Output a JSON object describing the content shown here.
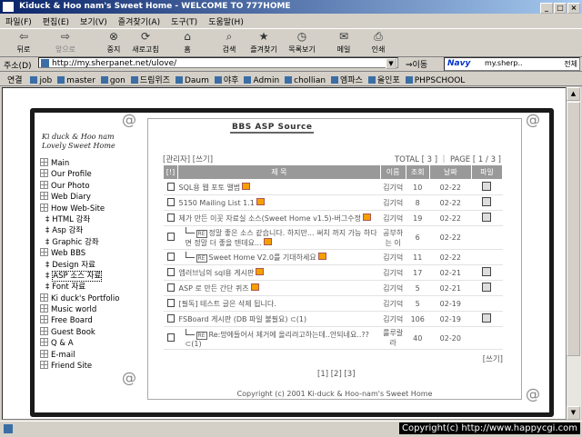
{
  "window": {
    "title_left": "Kiduck & Hoo nam's Sweet Home",
    "title_right": "- WELCOME TO 777HOME",
    "buttons": [
      "_",
      "□",
      "×"
    ]
  },
  "menu": [
    "파일(F)",
    "편집(E)",
    "보기(V)",
    "즐겨찾기(A)",
    "도구(T)",
    "도움말(H)"
  ],
  "toolbar": [
    {
      "label": "뒤로",
      "icon": "back-arrow-icon",
      "glyph": "⇦",
      "enabled": true
    },
    {
      "label": "앞으로",
      "icon": "forward-arrow-icon",
      "glyph": "⇨",
      "enabled": false
    },
    {
      "label": "중지",
      "icon": "stop-icon",
      "glyph": "⊗",
      "enabled": true
    },
    {
      "label": "새로고침",
      "icon": "refresh-icon",
      "glyph": "⟳",
      "enabled": true
    },
    {
      "label": "홈",
      "icon": "home-icon",
      "glyph": "⌂",
      "enabled": true
    },
    {
      "label": "검색",
      "icon": "search-icon",
      "glyph": "⌕",
      "enabled": true
    },
    {
      "label": "즐겨찾기",
      "icon": "favorites-icon",
      "glyph": "★",
      "enabled": true
    },
    {
      "label": "목록보기",
      "icon": "history-icon",
      "glyph": "◷",
      "enabled": true
    },
    {
      "label": "메일",
      "icon": "mail-icon",
      "glyph": "✉",
      "enabled": true
    },
    {
      "label": "인쇄",
      "icon": "print-icon",
      "glyph": "⎙",
      "enabled": true
    }
  ],
  "address": {
    "label": "주소(D)",
    "url": "http://my.sherpanet.net/ulove/",
    "go": "⇒이동",
    "navy_logo": "Navy",
    "navy_search": "my.sherp..",
    "navy_all": "전체"
  },
  "links": {
    "label": "연결",
    "items": [
      "job",
      "master",
      "gon",
      "드림위즈",
      "Daum",
      "야후",
      "Admin",
      "chollian",
      "엠파스",
      "올인포",
      "PHPSCHOOL"
    ]
  },
  "site": {
    "logo_line1": "Ki duck & Hoo nam",
    "logo_line2": "Lovely Sweet Home",
    "nav": [
      {
        "label": "Main",
        "sub": false,
        "selected": false
      },
      {
        "label": "Our Profile",
        "sub": false,
        "selected": false
      },
      {
        "label": "Our Photo",
        "sub": false,
        "selected": false
      },
      {
        "label": "Web Diary",
        "sub": false,
        "selected": false
      },
      {
        "label": "How Web-Site",
        "sub": false,
        "selected": false
      },
      {
        "label": "HTML 강좌",
        "sub": true,
        "selected": false
      },
      {
        "label": "Asp 강좌",
        "sub": true,
        "selected": false
      },
      {
        "label": "Graphic 강좌",
        "sub": true,
        "selected": false
      },
      {
        "label": "Web BBS",
        "sub": false,
        "selected": false
      },
      {
        "label": "Design 자료",
        "sub": true,
        "selected": false
      },
      {
        "label": "ASP 소스 자료",
        "sub": true,
        "selected": true
      },
      {
        "label": "Font 자료",
        "sub": true,
        "selected": false
      },
      {
        "label": "Ki duck's Portfolio",
        "sub": false,
        "selected": false
      },
      {
        "label": "Music world",
        "sub": false,
        "selected": false
      },
      {
        "label": "Free Board",
        "sub": false,
        "selected": false
      },
      {
        "label": "Guest Book",
        "sub": false,
        "selected": false
      },
      {
        "label": "Q & A",
        "sub": false,
        "selected": false
      },
      {
        "label": "E-mail",
        "sub": false,
        "selected": false
      },
      {
        "label": "Friend Site",
        "sub": false,
        "selected": false
      }
    ],
    "board": {
      "title": "BBS ASP Source",
      "admin": "[관리자]",
      "write": "[쓰기]",
      "total": "TOTAL [ 3 ] ｜ PAGE [ 1 / 3 ]",
      "columns": [
        "[!]",
        "제 목",
        "이름",
        "조회",
        "날짜",
        "파일"
      ],
      "rows": [
        {
          "title": "SQL용 웹 포토 앨범",
          "name": "김기덕",
          "views": "10",
          "date": "02-22",
          "reply": false,
          "new": true,
          "file": true
        },
        {
          "title": "5150 Mailing List 1.1",
          "name": "김기덕",
          "views": "8",
          "date": "02-22",
          "reply": false,
          "new": true,
          "file": true
        },
        {
          "title": "제가 만든 이꼿 자료실 소스(Sweet Home v1.5)-버그수정",
          "name": "김기덕",
          "views": "19",
          "date": "02-22",
          "reply": false,
          "new": true,
          "file": true
        },
        {
          "title": "정말 좋은 소스 같습니다. 하지만... 써치 까지 가능 하다면 정말 더 좋을 텐데요...",
          "name": "공부하는 이",
          "views": "6",
          "date": "02-22",
          "reply": true,
          "new": true,
          "file": false
        },
        {
          "title": "Sweet Home V2.0를 기대하세요",
          "name": "김기덕",
          "views": "11",
          "date": "02-22",
          "reply": true,
          "new": true,
          "file": false
        },
        {
          "title": "엡러브님의 sql용 게시판",
          "name": "김기덕",
          "views": "17",
          "date": "02-21",
          "reply": false,
          "new": true,
          "file": true
        },
        {
          "title": "ASP 로 만든 간단 퀴즈",
          "name": "김기덕",
          "views": "5",
          "date": "02-21",
          "reply": false,
          "new": true,
          "file": true
        },
        {
          "title": "[필독] 테스트 글은 삭제 됩니다.",
          "name": "김기덕",
          "views": "5",
          "date": "02-19",
          "reply": false,
          "new": false,
          "file": false
        },
        {
          "title": "FSBoard 게시판 (DB 파일 불필요) ⊂(1)",
          "name": "김기덕",
          "views": "106",
          "date": "02-19",
          "reply": false,
          "new": false,
          "file": true
        },
        {
          "title": "Re:망에들어서 제거에 올리려고하는데..안되네요..?? ⊂(1)",
          "name": "룰루랄라",
          "views": "40",
          "date": "02-20",
          "reply": true,
          "new": false,
          "file": false
        }
      ],
      "write_bottom": "[쓰기]",
      "pages": "[1]  [2]  [3]",
      "footer": "Copyright (c) 2001 Ki-duck & Hoo-nam's Sweet Home"
    }
  },
  "status": {
    "copyright": "Copyright(c) http://www.happycgi.com"
  }
}
